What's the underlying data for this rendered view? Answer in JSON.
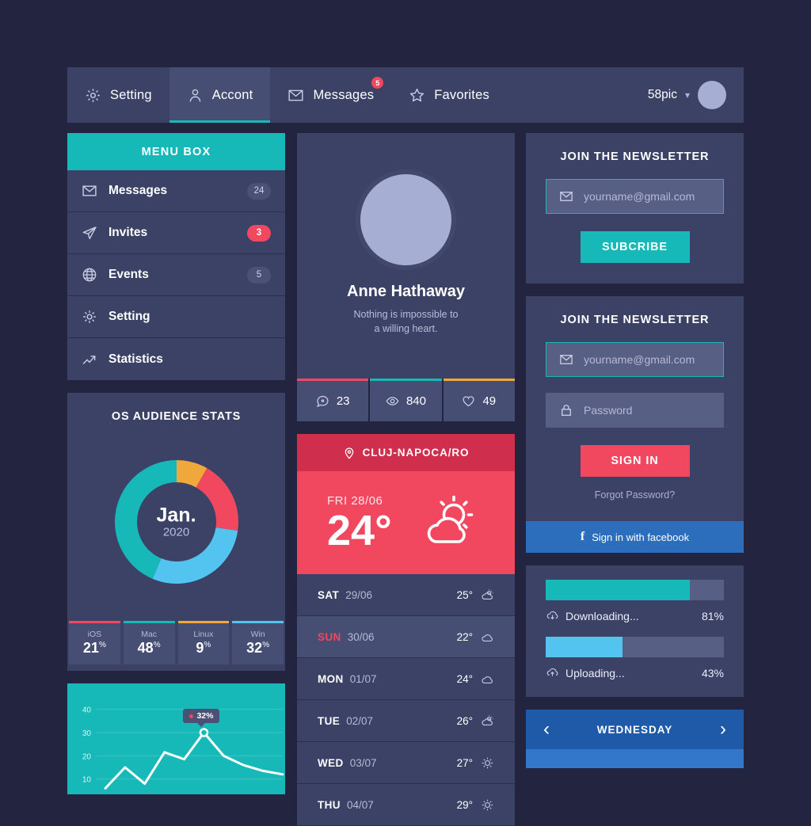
{
  "topnav": {
    "items": [
      {
        "label": "Setting",
        "icon": "gear-icon",
        "active": false
      },
      {
        "label": "Accont",
        "icon": "user-icon",
        "active": true
      },
      {
        "label": "Messages",
        "icon": "envelope-icon",
        "active": false,
        "badge": "5"
      },
      {
        "label": "Favorites",
        "icon": "star-icon",
        "active": false
      }
    ],
    "user_label": "58pic"
  },
  "menu_box": {
    "title": "MENU BOX",
    "items": [
      {
        "label": "Messages",
        "icon": "envelope-icon",
        "count": "24",
        "hot": false
      },
      {
        "label": "Invites",
        "icon": "paper-plane-icon",
        "count": "3",
        "hot": true
      },
      {
        "label": "Events",
        "icon": "globe-icon",
        "count": "5",
        "hot": false
      },
      {
        "label": "Setting",
        "icon": "gear-icon",
        "count": "",
        "hot": false
      },
      {
        "label": "Statistics",
        "icon": "trend-arrow-icon",
        "count": "",
        "hot": false
      }
    ]
  },
  "os_stats": {
    "title": "OS AUDIENCE STATS",
    "center_month": "Jan.",
    "center_year": "2020"
  },
  "profile": {
    "name": "Anne Hathaway",
    "quote_line1": "Nothing is impossible to",
    "quote_line2": "a willing heart.",
    "stats": [
      {
        "icon": "comment-icon",
        "value": "23",
        "color": "#f1485f"
      },
      {
        "icon": "eye-icon",
        "value": "840",
        "color": "#16b8b8"
      },
      {
        "icon": "heart-icon",
        "value": "49",
        "color": "#f0a83c"
      }
    ]
  },
  "weather": {
    "location": "CLUJ-NAPOCA/RO",
    "today": {
      "day": "FRI",
      "date": "28/06",
      "temp": "24°",
      "icon": "sun-behind-cloud-icon"
    },
    "forecast": [
      {
        "day": "SAT",
        "date": "29/06",
        "temp": "25°",
        "icon": "sun-behind-cloud-icon",
        "highlight": false
      },
      {
        "day": "SUN",
        "date": "30/06",
        "temp": "22°",
        "icon": "cloud-icon",
        "highlight": true
      },
      {
        "day": "MON",
        "date": "01/07",
        "temp": "24°",
        "icon": "cloud-icon",
        "highlight": false
      },
      {
        "day": "TUE",
        "date": "02/07",
        "temp": "26°",
        "icon": "sun-behind-cloud-icon",
        "highlight": false
      },
      {
        "day": "WED",
        "date": "03/07",
        "temp": "27°",
        "icon": "sun-icon",
        "highlight": false
      },
      {
        "day": "THU",
        "date": "04/07",
        "temp": "29°",
        "icon": "sun-icon",
        "highlight": false
      }
    ]
  },
  "newsletter": {
    "title": "JOIN THE NEWSLETTER",
    "email_placeholder": "yourname@gmail.com",
    "email_value": "",
    "button_label": "SUBCRIBE"
  },
  "signin": {
    "title": "JOIN THE NEWSLETTER",
    "email_placeholder": "yourname@gmail.com",
    "email_value": "",
    "password_placeholder": "Password",
    "password_value": "",
    "button_label": "SIGN IN",
    "forgot_label": "Forgot Password?",
    "facebook_label": "Sign in with facebook"
  },
  "progress": {
    "rows": [
      {
        "label": "Downloading...",
        "pct_label": "81%",
        "pct": 81,
        "color": "#16b8b8",
        "icon": "cloud-download-icon"
      },
      {
        "label": "Uploading...",
        "pct_label": "43%",
        "pct": 43,
        "color": "#53c3f0",
        "icon": "cloud-upload-icon"
      }
    ]
  },
  "daybar": {
    "label": "WEDNESDAY",
    "prev_icon": "chevron-left-icon",
    "next_icon": "chevron-right-icon"
  },
  "colors": {
    "page_bg": "#222440",
    "card_bg": "#3b4266",
    "card_bg_light": "#474e74",
    "teal": "#16b8b8",
    "pink": "#f1485f",
    "pink_dark": "#cf2f4c",
    "amber": "#f0a83c",
    "blue": "#53c3f0",
    "facebook_blue": "#2d6ebc",
    "daybar_blue": "#1f5aa8"
  },
  "chart_data": [
    {
      "type": "pie",
      "title": "OS AUDIENCE STATS",
      "labels": [
        "iOS",
        "Mac",
        "Linux",
        "Win"
      ],
      "values": [
        21,
        48,
        9,
        32
      ],
      "value_labels": [
        "21%",
        "48%",
        "9%",
        "32%"
      ],
      "colors": [
        "#f1485f",
        "#16b8b8",
        "#f0a83c",
        "#53c3f0"
      ],
      "center_label": "Jan. 2020",
      "donut": true,
      "legend": "bottom"
    },
    {
      "type": "line",
      "title": "",
      "x": [
        1,
        2,
        3,
        4,
        5,
        6,
        7,
        8,
        9,
        10
      ],
      "values": [
        6,
        15,
        8,
        21.5,
        18.5,
        30,
        20,
        16,
        13.5,
        12
      ],
      "ylabel": "",
      "xlabel": "",
      "ylim": [
        0,
        45
      ],
      "yticks": [
        10,
        20,
        30,
        40
      ],
      "ytick_labels": [
        "10",
        "20",
        "30",
        "40"
      ],
      "grid": true,
      "line_color": "#ffffff",
      "plot_bg": "#16b8b8",
      "annotations": [
        {
          "text": "32%",
          "x": 6,
          "y": 30,
          "marker": true
        }
      ]
    }
  ]
}
